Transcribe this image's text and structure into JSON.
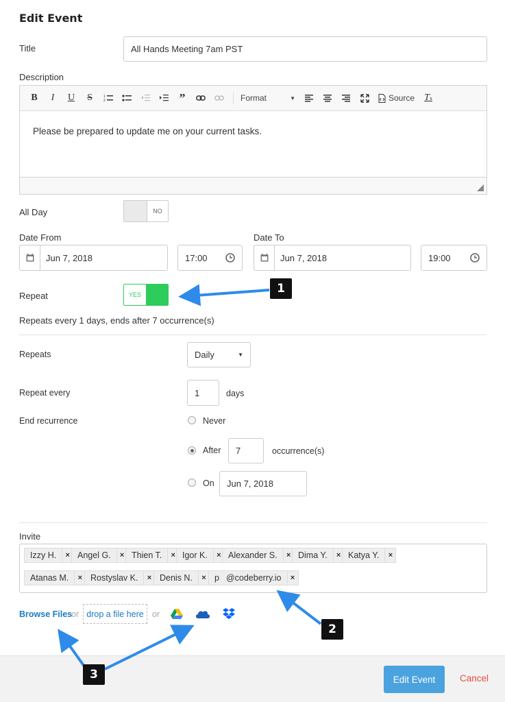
{
  "header": {
    "title": "Edit Event"
  },
  "title_field": {
    "label": "Title",
    "value": "All Hands Meeting 7am PST"
  },
  "description": {
    "label": "Description",
    "body": "Please be prepared to update me on your current tasks.",
    "toolbar": {
      "format_label": "Format",
      "source_label": "Source"
    }
  },
  "all_day": {
    "label": "All Day",
    "state": "NO"
  },
  "date_from": {
    "label": "Date From",
    "date": "Jun 7, 2018",
    "time": "17:00"
  },
  "date_to": {
    "label": "Date To",
    "date": "Jun 7, 2018",
    "time": "19:00"
  },
  "repeat": {
    "label": "Repeat",
    "state": "YES",
    "summary": "Repeats every 1 days, ends after 7 occurrence(s)"
  },
  "recurrence": {
    "repeats_label": "Repeats",
    "repeats_value": "Daily",
    "repeat_every_label": "Repeat every",
    "repeat_every_value": "1",
    "repeat_every_unit": "days",
    "end_label": "End recurrence",
    "never_label": "Never",
    "after_label": "After",
    "after_value": "7",
    "after_unit": "occurrence(s)",
    "on_label": "On",
    "on_value": "Jun 7, 2018"
  },
  "invite": {
    "label": "Invite",
    "tags": [
      "Izzy H.",
      "Angel G.",
      "Thien T.",
      "Igor K.",
      "Alexander S.",
      "Dima Y.",
      "Katya Y.",
      "Atanas M.",
      "Rostyslav K.",
      "Denis N.",
      "p    @codeberry.io"
    ],
    "remove_symbol": "×"
  },
  "files": {
    "browse_label": "Browse Files",
    "or": "or",
    "drop_label": "drop a file here"
  },
  "callouts": [
    "1",
    "2",
    "3"
  ],
  "footer": {
    "primary_label": "Edit Event",
    "cancel_label": "Cancel"
  },
  "colors": {
    "toggle_yes": "#2ecc5a",
    "primary": "#4aa3df",
    "cancel": "#e74c3c",
    "link": "#1a7bc4",
    "arrow": "#2f8bea"
  }
}
